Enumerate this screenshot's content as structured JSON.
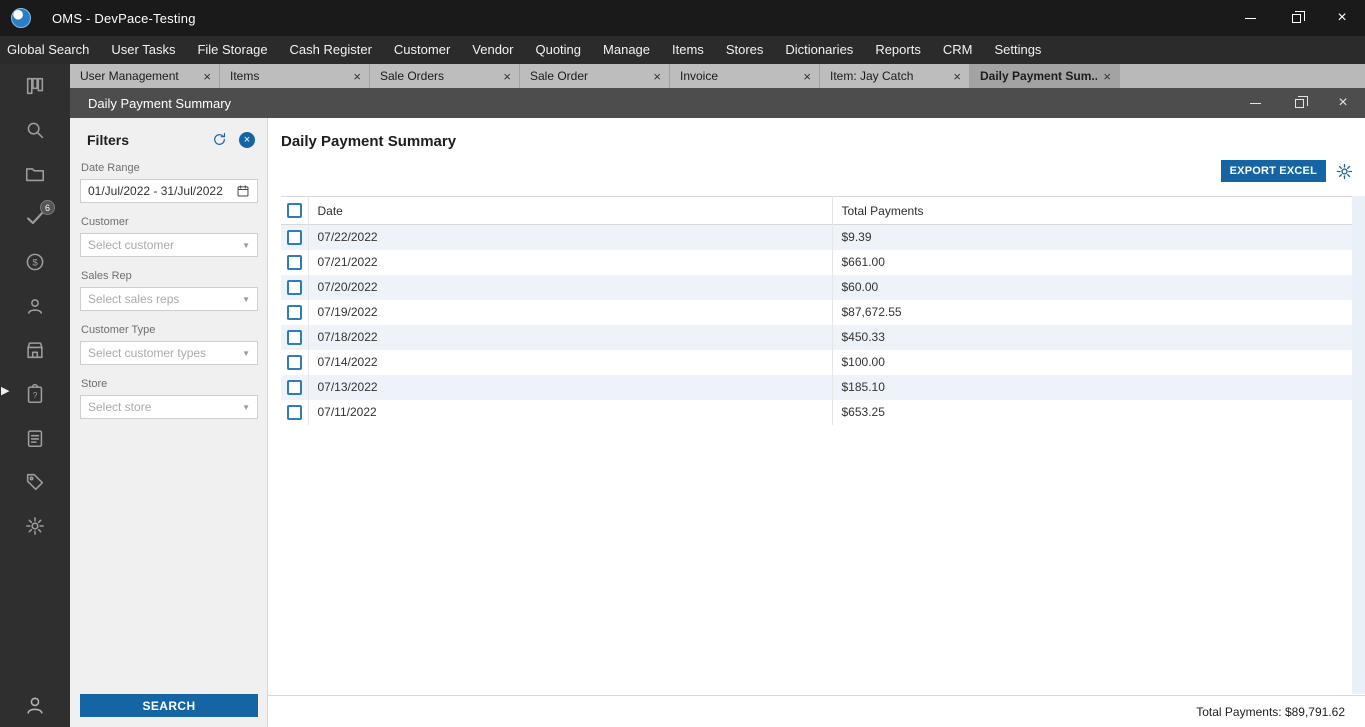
{
  "window": {
    "title": "OMS - DevPace-Testing"
  },
  "menu": {
    "items": [
      "Global Search",
      "User Tasks",
      "File Storage",
      "Cash Register",
      "Customer",
      "Vendor",
      "Quoting",
      "Manage",
      "Items",
      "Stores",
      "Dictionaries",
      "Reports",
      "CRM",
      "Settings"
    ]
  },
  "tabs": [
    {
      "label": "User Management",
      "active": false
    },
    {
      "label": "Items",
      "active": false
    },
    {
      "label": "Sale Orders",
      "active": false
    },
    {
      "label": "Sale Order",
      "active": false
    },
    {
      "label": "Invoice",
      "active": false
    },
    {
      "label": "Item: Jay Catch",
      "active": false
    },
    {
      "label": "Daily Payment Sum...",
      "active": true
    }
  ],
  "sidebar": {
    "items": [
      {
        "name": "dashboard"
      },
      {
        "name": "search"
      },
      {
        "name": "folder"
      },
      {
        "name": "tasks",
        "badge": "6"
      },
      {
        "name": "payments"
      },
      {
        "name": "contacts"
      },
      {
        "name": "store"
      },
      {
        "name": "clipboard-question"
      },
      {
        "name": "clipboard-list"
      },
      {
        "name": "tags"
      },
      {
        "name": "settings"
      }
    ],
    "bottom_item": {
      "name": "user"
    }
  },
  "inner_window": {
    "title": "Daily Payment Summary"
  },
  "filters": {
    "title": "Filters",
    "fields": [
      {
        "label": "Date Range",
        "type": "date",
        "value": "01/Jul/2022 - 31/Jul/2022"
      },
      {
        "label": "Customer",
        "type": "select",
        "placeholder": "Select customer"
      },
      {
        "label": "Sales Rep",
        "type": "select",
        "placeholder": "Select sales reps"
      },
      {
        "label": "Customer Type",
        "type": "select",
        "placeholder": "Select customer types"
      },
      {
        "label": "Store",
        "type": "select",
        "placeholder": "Select store"
      }
    ],
    "search_label": "SEARCH"
  },
  "main": {
    "title": "Daily Payment Summary",
    "export_label": "EXPORT EXCEL",
    "table": {
      "columns": [
        "Date",
        "Total Payments"
      ],
      "rows": [
        {
          "date": "07/22/2022",
          "total": "$9.39"
        },
        {
          "date": "07/21/2022",
          "total": "$661.00"
        },
        {
          "date": "07/20/2022",
          "total": "$60.00"
        },
        {
          "date": "07/19/2022",
          "total": "$87,672.55"
        },
        {
          "date": "07/18/2022",
          "total": "$450.33"
        },
        {
          "date": "07/14/2022",
          "total": "$100.00"
        },
        {
          "date": "07/13/2022",
          "total": "$185.10"
        },
        {
          "date": "07/11/2022",
          "total": "$653.25"
        }
      ]
    },
    "footer_total": "Total Payments: $89,791.62"
  },
  "colors": {
    "accent": "#1565a5",
    "row_alt": "#edf3f9",
    "cb": "#2e7cb8"
  }
}
